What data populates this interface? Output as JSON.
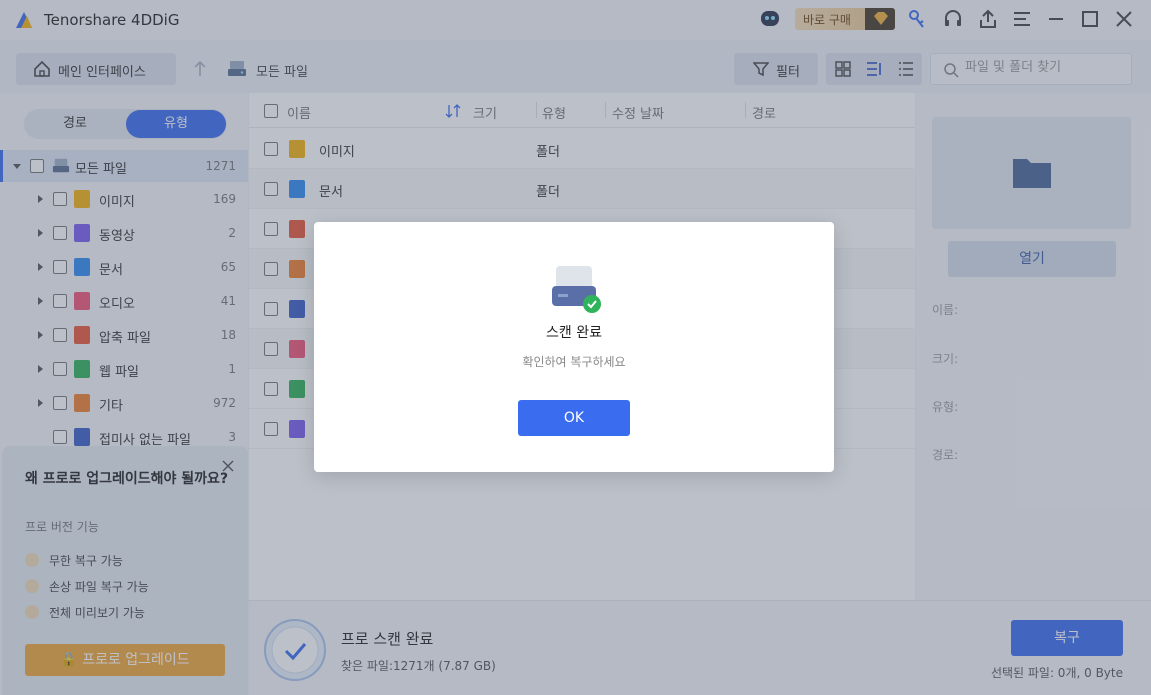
{
  "app": {
    "title": "Tenorshare 4DDiG"
  },
  "titlebar": {
    "buy_label": "바로 구매"
  },
  "toolbar": {
    "home_label": "메인 인터페이스",
    "breadcrumb": "모든 파일",
    "filter_label": "필터",
    "search_placeholder": "파일 및 폴더 찾기"
  },
  "sidebar": {
    "tab_path": "경로",
    "tab_type": "유형",
    "root": {
      "label": "모든 파일",
      "count": "1271"
    },
    "items": [
      {
        "label": "이미지",
        "count": "169",
        "icon": "image-icon",
        "color": "#f5b40f"
      },
      {
        "label": "동영상",
        "count": "2",
        "icon": "video-icon",
        "color": "#7b5cf0"
      },
      {
        "label": "문서",
        "count": "65",
        "icon": "document-icon",
        "color": "#2f8cf0"
      },
      {
        "label": "오디오",
        "count": "41",
        "icon": "audio-icon",
        "color": "#f0567a"
      },
      {
        "label": "압축 파일",
        "count": "18",
        "icon": "archive-icon",
        "color": "#e8583a"
      },
      {
        "label": "웹 파일",
        "count": "1",
        "icon": "web-icon",
        "color": "#2fb35b"
      },
      {
        "label": "기타",
        "count": "972",
        "icon": "other-icon",
        "color": "#f08030"
      },
      {
        "label": "접미사 없는 파일",
        "count": "3",
        "icon": "unknown-icon",
        "color": "#3a5ec8"
      }
    ]
  },
  "upgrade": {
    "title": "왜 프로로 업그레이드해야 될까요?",
    "subtitle": "프로 버전 기능",
    "features": [
      "무한 복구 가능",
      "손상 파일 복구 가능",
      "전체 미리보기 가능"
    ],
    "button": "프로로 업그레이드"
  },
  "list": {
    "headers": {
      "name": "이름",
      "size": "크기",
      "type": "유형",
      "modified": "수정 날짜",
      "path": "경로"
    },
    "rows": [
      {
        "name": "이미지",
        "type": "폴더"
      },
      {
        "name": "문서",
        "type": "폴더"
      }
    ]
  },
  "preview": {
    "open_label": "열기",
    "labels": [
      "이름:",
      "크기:",
      "유형:",
      "경로:"
    ]
  },
  "bottom": {
    "scan_title": "프로 스캔 완료",
    "scan_sub": "찾은 파일:1271개 (7.87 GB)",
    "recover_label": "복구",
    "selected_info": "선택된 파일: 0개, 0 Byte"
  },
  "modal": {
    "title": "스캔 완료",
    "subtitle": "확인하여 복구하세요",
    "ok_label": "OK"
  }
}
